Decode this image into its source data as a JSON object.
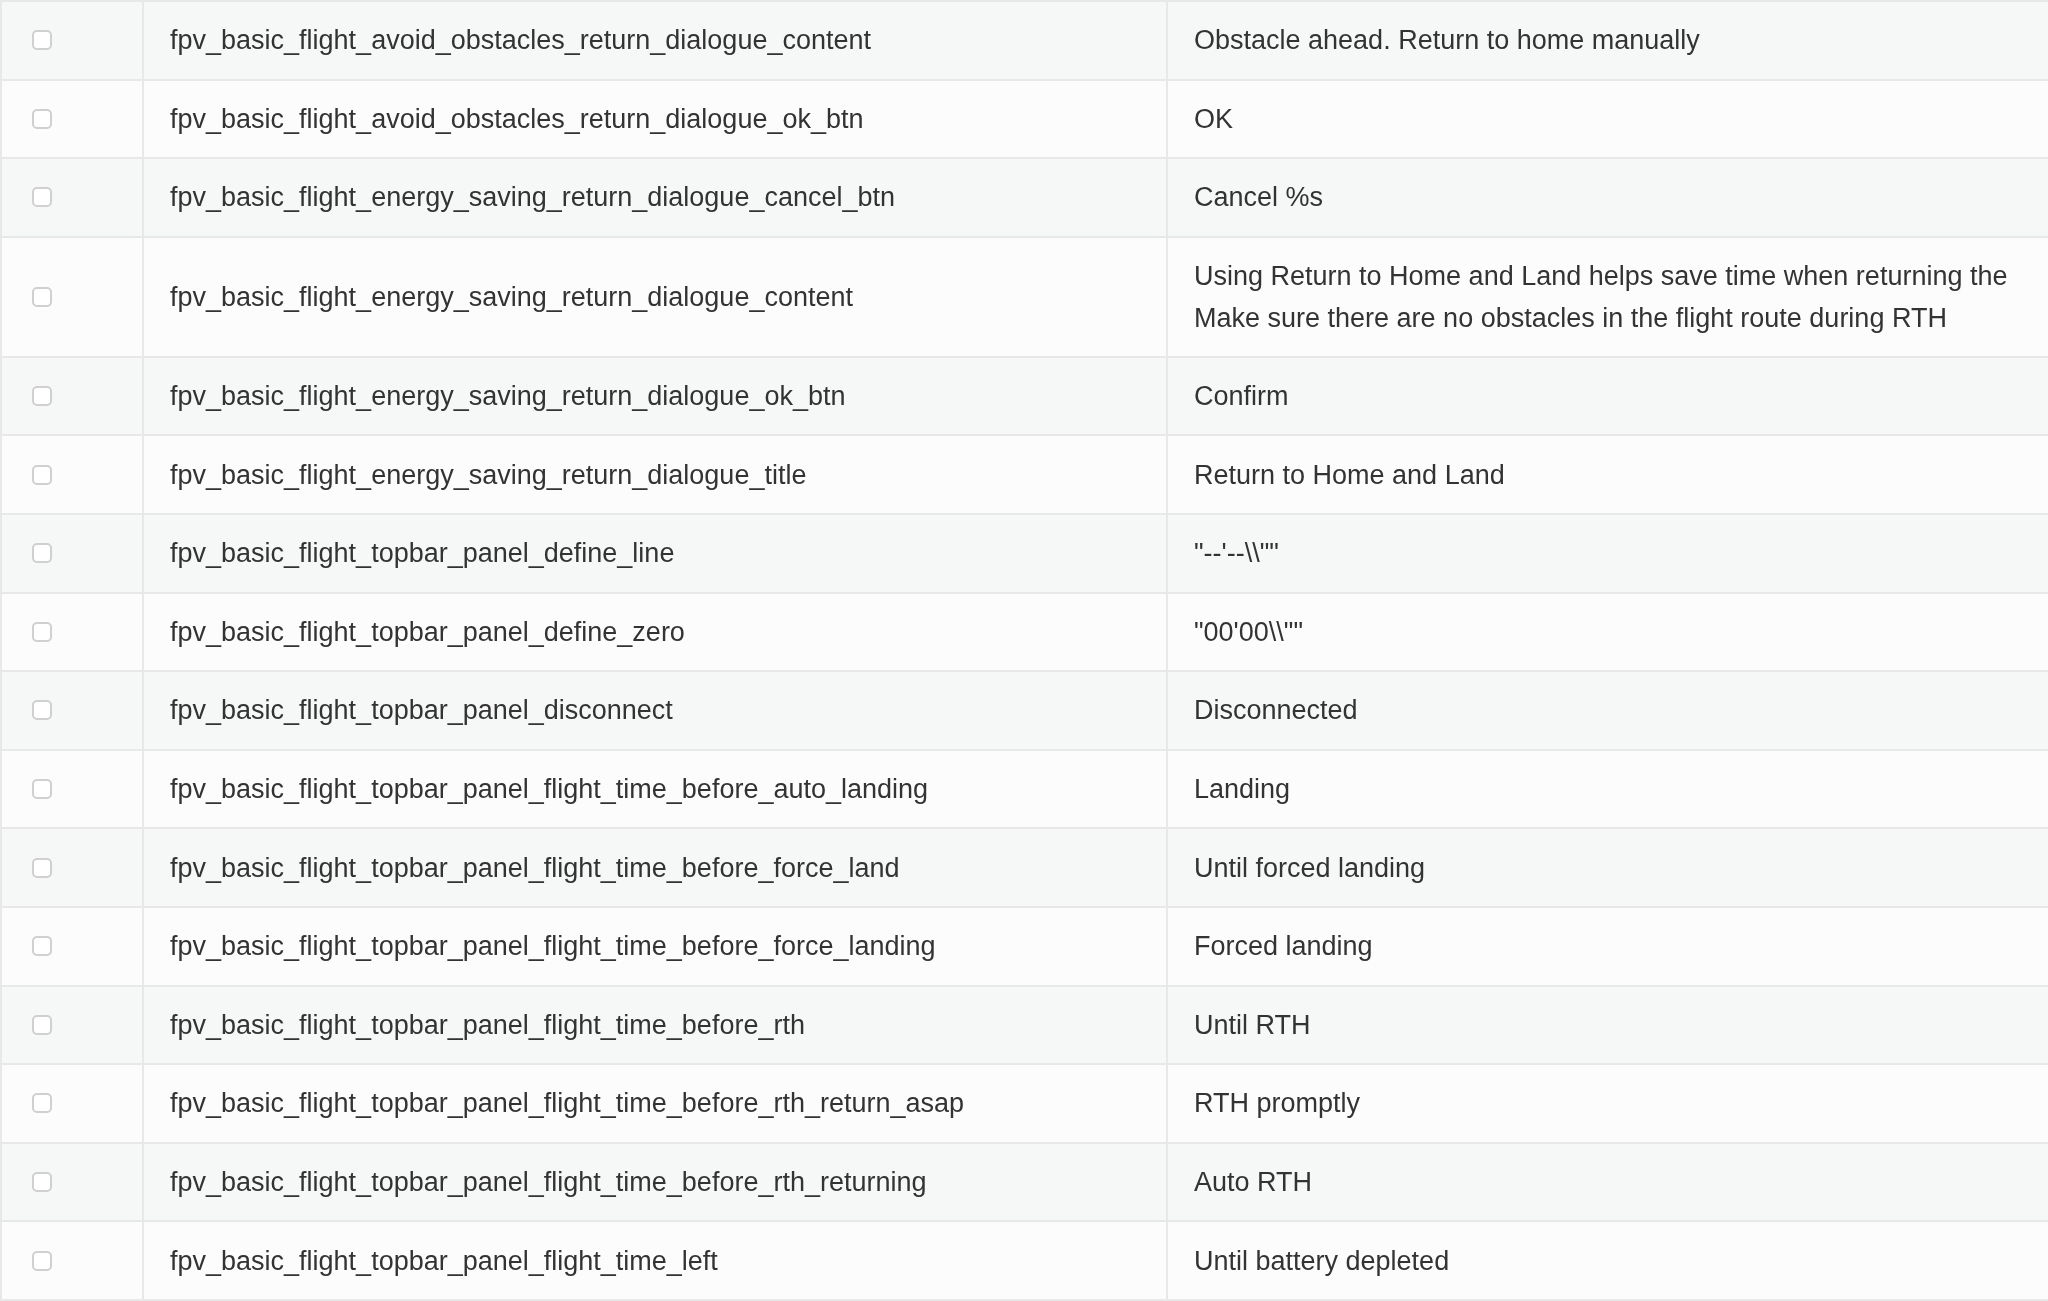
{
  "table": {
    "rows": [
      {
        "checked": false,
        "key": "fpv_basic_flight_avoid_obstacles_return_dialogue_content",
        "value": [
          "Obstacle ahead. Return to home manually"
        ]
      },
      {
        "checked": false,
        "key": "fpv_basic_flight_avoid_obstacles_return_dialogue_ok_btn",
        "value": [
          "OK"
        ]
      },
      {
        "checked": false,
        "key": "fpv_basic_flight_energy_saving_return_dialogue_cancel_btn",
        "value": [
          "Cancel %s"
        ]
      },
      {
        "checked": false,
        "key": "fpv_basic_flight_energy_saving_return_dialogue_content",
        "value": [
          "Using Return to Home and Land helps save time when returning the",
          "Make sure there are no obstacles in the flight route during RTH"
        ]
      },
      {
        "checked": false,
        "key": "fpv_basic_flight_energy_saving_return_dialogue_ok_btn",
        "value": [
          "Confirm"
        ]
      },
      {
        "checked": false,
        "key": "fpv_basic_flight_energy_saving_return_dialogue_title",
        "value": [
          "Return to Home and Land"
        ]
      },
      {
        "checked": false,
        "key": "fpv_basic_flight_topbar_panel_define_line",
        "value": [
          "\"--'--\\\\\"\""
        ]
      },
      {
        "checked": false,
        "key": "fpv_basic_flight_topbar_panel_define_zero",
        "value": [
          "\"00'00\\\\\"\""
        ]
      },
      {
        "checked": false,
        "key": "fpv_basic_flight_topbar_panel_disconnect",
        "value": [
          "Disconnected"
        ]
      },
      {
        "checked": false,
        "key": "fpv_basic_flight_topbar_panel_flight_time_before_auto_landing",
        "value": [
          "Landing"
        ]
      },
      {
        "checked": false,
        "key": "fpv_basic_flight_topbar_panel_flight_time_before_force_land",
        "value": [
          "Until forced landing"
        ]
      },
      {
        "checked": false,
        "key": "fpv_basic_flight_topbar_panel_flight_time_before_force_landing",
        "value": [
          "Forced landing"
        ]
      },
      {
        "checked": false,
        "key": "fpv_basic_flight_topbar_panel_flight_time_before_rth",
        "value": [
          "Until RTH"
        ]
      },
      {
        "checked": false,
        "key": "fpv_basic_flight_topbar_panel_flight_time_before_rth_return_asap",
        "value": [
          "RTH promptly"
        ]
      },
      {
        "checked": false,
        "key": "fpv_basic_flight_topbar_panel_flight_time_before_rth_returning",
        "value": [
          "Auto RTH"
        ]
      },
      {
        "checked": false,
        "key": "fpv_basic_flight_topbar_panel_flight_time_left",
        "value": [
          "Until battery depleted"
        ]
      }
    ]
  }
}
